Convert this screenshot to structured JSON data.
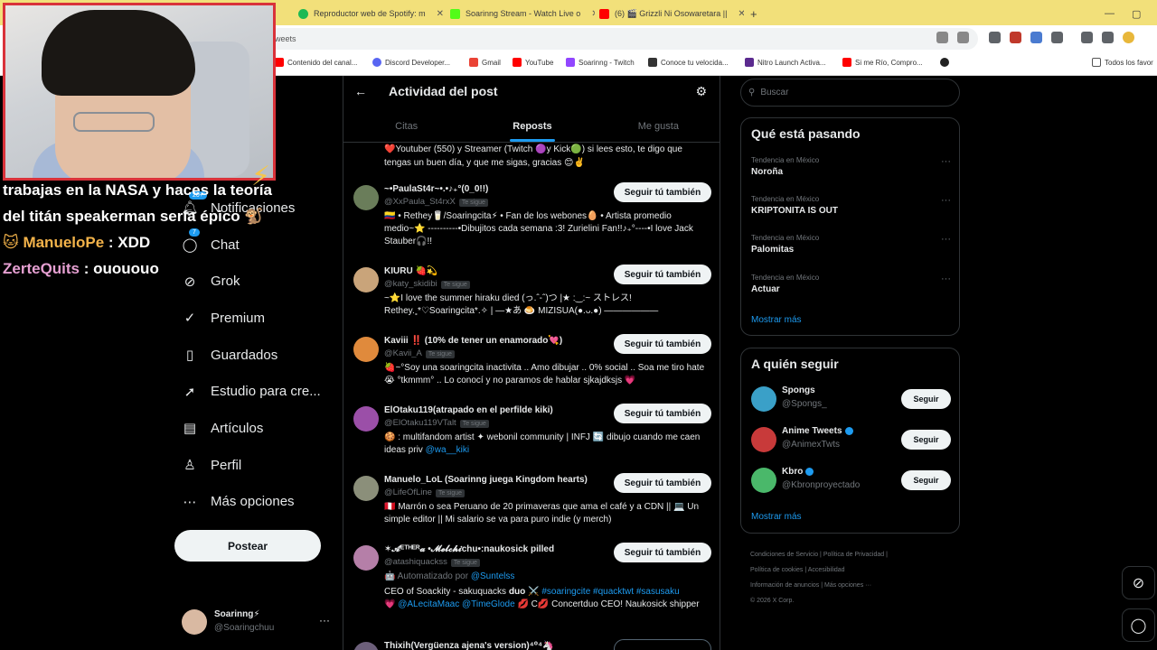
{
  "browser": {
    "tabs": [
      {
        "label": "Reproductor web de Spotify: m",
        "color": "#1db954"
      },
      {
        "label": "Soarinng Stream - Watch Live o",
        "color": "#53fc18"
      },
      {
        "label": "(6) 🎬 Grizzli Ni Osowaretara ||",
        "color": "#ff0000"
      }
    ],
    "new_tab": "+",
    "address": "weets",
    "bookmarks": [
      "Contenido del canal...",
      "Discord Developer...",
      "Gmail",
      "YouTube",
      "Soarinng - Twitch",
      "Conoce tu velocida...",
      "Nitro Launch Activa...",
      "Si me Río, Compro...",
      "Todos los favor"
    ]
  },
  "overlay": {
    "chat_lines": [
      {
        "user": "",
        "msg": "trabajas en la NASA y haces la teoría del titán speakerman sería épico 🐒"
      },
      {
        "user": "🐱 ManueloPe",
        "msg": " : XDD"
      },
      {
        "user": "ZerteQuits",
        "msg": " : ouououo"
      }
    ]
  },
  "nav": {
    "notif_badge": "20+",
    "chat_badge": "7",
    "items": [
      {
        "label": "Notificaciones",
        "icon": "bell-icon"
      },
      {
        "label": "Chat",
        "icon": "chat-icon"
      },
      {
        "label": "Grok",
        "icon": "grok-icon"
      },
      {
        "label": "Premium",
        "icon": "premium-icon"
      },
      {
        "label": "Guardados",
        "icon": "bookmark-icon"
      },
      {
        "label": "Estudio para cre...",
        "icon": "rocket-icon"
      },
      {
        "label": "Artículos",
        "icon": "article-icon"
      },
      {
        "label": "Perfil",
        "icon": "person-icon"
      },
      {
        "label": "Más opciones",
        "icon": "more-icon"
      }
    ],
    "post_label": "Postear",
    "me": {
      "name": "Soarinng⚡",
      "handle": "@Soaringchuu"
    }
  },
  "main": {
    "title": "Actividad del post",
    "tabs": [
      "Citas",
      "Reposts",
      "Me gusta"
    ],
    "active_tab": "Reposts",
    "continuation": "❤️Youtuber (550) y Streamer (Twitch 🟣y Kick🟢) si lees esto, te digo que tengas un buen día, y que me sigas, gracias 😊✌️",
    "follow_label": "Seguir tú también",
    "follows_you": "Te sigue",
    "users": [
      {
        "name": "~•PaulaSt4r~•.•♪₊°(0_0!!)",
        "handle": "@XxPaula_St4rxX",
        "bio": "🇨🇴 • Rethey🥛/Soaringcita⚡ • Fan de los webones🥚 • Artista promedio medio~⭐ ----------•Dibujitos cada semana :3! Zurielini Fan!!♪₊°----•I love Jack Stauber🎧!!",
        "color": "#6a7d5a"
      },
      {
        "name": "KIURU 🍓💫",
        "handle": "@katy_skidibi",
        "bio": "~⭐I love the summer hiraku died (っ.ˆ-ˆ)つ |★      :‿:~     ストレス! Rethey.˳*♡Soaringcita*.✧ | —★あ 🍮 MIZISUA(●.ᴗ.●) ——————",
        "color": "#c9a47a"
      },
      {
        "name": "Kaviii ‼️ (10% de tener un enamorado💘)",
        "handle": "@Kavii_A",
        "bio": "🍓~°Soy una soaringcita inactivita .. Amo dibujar .. 0% social .. Soa me tiro hate 😭 °tkmmm° .. Lo conocí y no paramos de hablar sjkajdksjs 💗",
        "color": "#e08a3c"
      },
      {
        "name": "ElOtaku119(atrapado en el perfilde kiki)",
        "handle": "@ElOtaku119VTalt",
        "bio": "🍪 : multifandom artist ✦ webonil community | INFJ 🔄 dibujo cuando me caen ideas priv ",
        "bio_link": "@wa__kiki",
        "color": "#9b4fa8"
      },
      {
        "name": "Manuelo_LoL (Soarinng juega Kingdom hearts)",
        "handle": "@LifeOfLine",
        "bio": "🇵🇪 Marrón o sea Peruano de 20 primaveras que ama el café y a CDN || 💻 Un simple editor || Mi salario se va para puro indie (y merch)",
        "color": "#8b8f7a"
      },
      {
        "name": "✶𝓐ᴱᵀᴴᴱᴿ𝓪 •𝓜𝓮𝓵𝓬𝓱𝓲chu•:naukosick pilled",
        "handle": "@atashiquackss",
        "auto": "🤖 Automatizado por ",
        "auto_link": "@Suntelss",
        "bio": "CEO of Soackity - sakuquacks 𝐝𝐮𝐨 ⚔️ ",
        "bio_tags": "#soaringcite #quacktwt #sasusaku",
        "bio2": "💗 ",
        "bio2_links": "@ALecitaMaac @TimeGlode",
        "bio3": " 💋 C💋 Concertduo CEO! Naukosick shipper",
        "color": "#b57fa8"
      },
      {
        "name": "Thixih(Vergüenza ajena's version)⁴⁰⁴🦄",
        "handle": "",
        "bio": "",
        "color": "#6c5f7a"
      }
    ]
  },
  "right": {
    "search_placeholder": "Buscar",
    "trending_title": "Qué está pasando",
    "trends": [
      {
        "category": "Tendencia en México",
        "name": "Noroña"
      },
      {
        "category": "Tendencia en México",
        "name": "KRIPTONITA IS OUT"
      },
      {
        "category": "Tendencia en México",
        "name": "Palomitas"
      },
      {
        "category": "Tendencia en México",
        "name": "Actuar"
      }
    ],
    "show_more": "Mostrar más",
    "wtf_title": "A quién seguir",
    "wtf": [
      {
        "name": "Spongs",
        "handle": "@Spongs_",
        "verified": false,
        "color": "#3aa0c8"
      },
      {
        "name": "Anime Tweets",
        "handle": "@AnimexTwts",
        "verified": true,
        "color": "#c83a3a"
      },
      {
        "name": "Kbro",
        "handle": "@Kbronproyectado",
        "verified": true,
        "color": "#4ab86a"
      }
    ],
    "follow_label": "Seguir",
    "footer": [
      "Condiciones de Servicio",
      "Política de Privacidad",
      "Política de cookies",
      "Accesibilidad",
      "Información de anuncios",
      "Más opciones ···",
      "© 2026 X Corp."
    ]
  }
}
